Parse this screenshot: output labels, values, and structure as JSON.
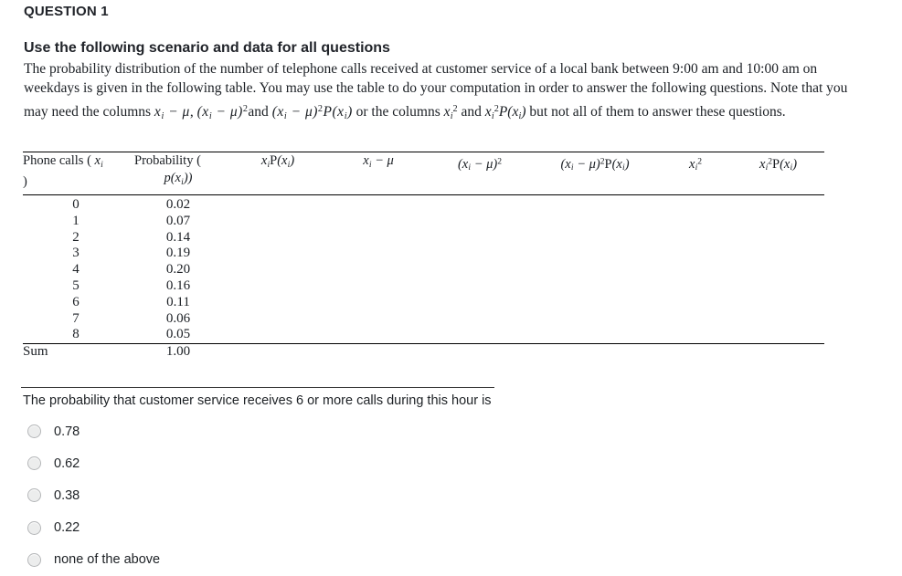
{
  "question": {
    "label": "QUESTION 1"
  },
  "scenario": {
    "title": "Use the following scenario and data for all questions",
    "line1_a": "The probability distribution of the number of telephone calls received at customer service of a local bank between 9:00 am and 10:00 am on",
    "line2_a": "weekdays is given in the following table. You may use the table to do your computation in order to answer the following questions. Note that you",
    "line3_a": "may need the columns",
    "line3_m1": "x",
    "line3_m1_sub": "i",
    "line3_m1_rest": "− μ",
    "line3_b": ",",
    "line3_m2": "(x",
    "line3_m2_sub": "i",
    "line3_m2_rest": "− μ)",
    "line3_m2_sup": "2",
    "line3_c": "and",
    "line3_m3_sup": "2",
    "line3_m3_tail": "P(x",
    "line3_m3_tail_sub": "i",
    "line3_m3_tail_end": ")",
    "line3_d": "or the columns",
    "line3_m4": "x",
    "line3_m4_sub": "i",
    "line3_m4_sup": "2",
    "line3_e": "and",
    "line3_f": "but not all of them to answer these questions."
  },
  "table": {
    "headers": {
      "col1_line1": "Phone calls (",
      "col1_x": "x",
      "col1_sub": "i",
      "col1_line2": ")",
      "col2_line1": "Probability (",
      "col2_p": "p",
      "col2_x": "(x",
      "col2_sub": "i",
      "col2_close": "))",
      "col3": "x P(x )",
      "col4": "x − μ",
      "col5": "(x − μ)²",
      "col6": "(x − μ)² P(x )",
      "col7": "x²",
      "col8": "x² P(x )"
    },
    "rows": [
      {
        "x": "0",
        "p": "0.02"
      },
      {
        "x": "1",
        "p": "0.07"
      },
      {
        "x": "2",
        "p": "0.14"
      },
      {
        "x": "3",
        "p": "0.19"
      },
      {
        "x": "4",
        "p": "0.20"
      },
      {
        "x": "5",
        "p": "0.16"
      },
      {
        "x": "6",
        "p": "0.11"
      },
      {
        "x": "7",
        "p": "0.06"
      },
      {
        "x": "8",
        "p": "0.05"
      }
    ],
    "sum_label": "Sum",
    "sum_value": "1.00"
  },
  "prompt": "The probability that customer service receives 6 or more calls during this hour is",
  "options": [
    {
      "label": "0.78",
      "selected": false
    },
    {
      "label": "0.62",
      "selected": false
    },
    {
      "label": "0.38",
      "selected": false
    },
    {
      "label": "0.22",
      "selected": false
    },
    {
      "label": "none of the above",
      "selected": false
    }
  ],
  "colors": {
    "text": "#1d2125",
    "rule": "#000000",
    "radio_fill": "#eceded",
    "radio_border": "#b4b6b8",
    "background": "#ffffff"
  }
}
